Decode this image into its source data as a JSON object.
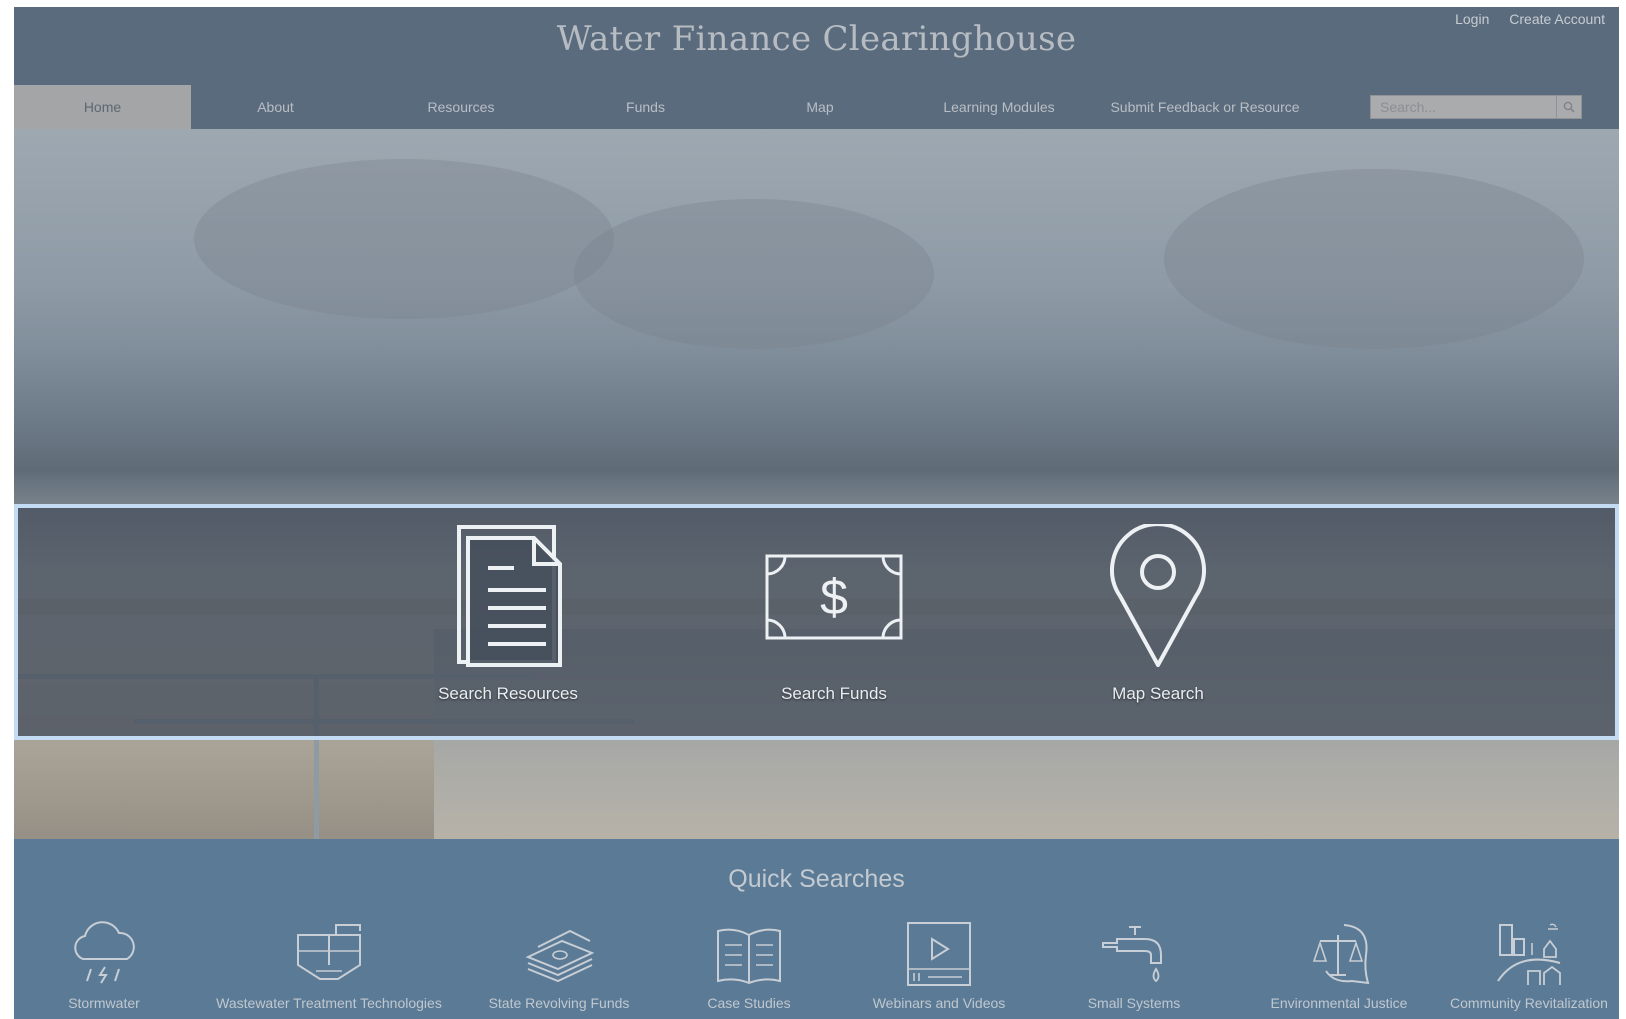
{
  "header": {
    "site_title": "Water Finance Clearinghouse",
    "account_links": {
      "login": "Login",
      "create_account": "Create Account"
    }
  },
  "nav": {
    "items": [
      "Home",
      "About",
      "Resources",
      "Funds",
      "Map",
      "Learning Modules",
      "Submit Feedback or Resource"
    ],
    "active": "Home"
  },
  "search": {
    "placeholder": "Search...",
    "icon": "search-icon"
  },
  "hero": {
    "actions": [
      {
        "label": "Search Resources",
        "icon": "document-icon"
      },
      {
        "label": "Search Funds",
        "icon": "dollar-bill-icon"
      },
      {
        "label": "Map Search",
        "icon": "map-pin-icon"
      }
    ]
  },
  "quick_searches": {
    "title": "Quick Searches",
    "items": [
      {
        "label": "Stormwater",
        "icon": "rain-cloud-icon"
      },
      {
        "label": "Wastewater Treatment Technologies",
        "icon": "treatment-tank-icon"
      },
      {
        "label": "State Revolving Funds",
        "icon": "money-stack-icon"
      },
      {
        "label": "Case Studies",
        "icon": "open-book-icon"
      },
      {
        "label": "Webinars and Videos",
        "icon": "video-player-icon"
      },
      {
        "label": "Small Systems",
        "icon": "faucet-icon"
      },
      {
        "label": "Environmental Justice",
        "icon": "justice-scale-icon"
      },
      {
        "label": "Community Revitalization",
        "icon": "community-icon"
      }
    ]
  },
  "colors": {
    "header_bg": "#5a6b7e",
    "nav_active_bg": "#a4a5a6",
    "band_border": "#c3dcf3",
    "quick_bg": "#5b7a95"
  }
}
